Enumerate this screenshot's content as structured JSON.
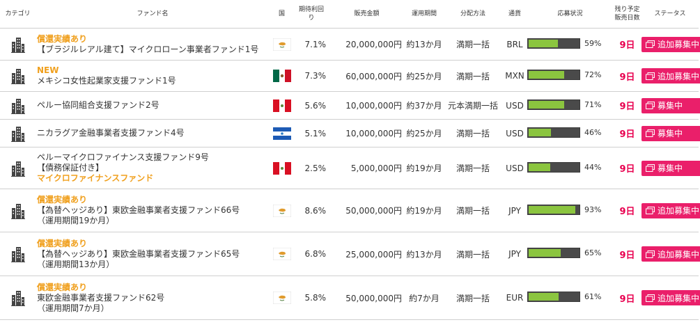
{
  "headers": {
    "category": "カテゴリ",
    "fund_name": "ファンド名",
    "country": "国",
    "yield_l1": "期待利回",
    "yield_l2": "り",
    "amount": "販売金額",
    "period": "運用期間",
    "distribution": "分配方法",
    "currency": "通貨",
    "status_progress": "応募状況",
    "days_l1": "残り予定",
    "days_l2": "販売日数",
    "status": "ステータス"
  },
  "rows": [
    {
      "tag": "償還実績あり",
      "name_lines": [
        "【ブラジルレアル建て】マイクロローン事業者ファンド1号"
      ],
      "tag_bottom": "",
      "flag": "cyprus-flag",
      "yield": "7.1%",
      "amount": "20,000,000円",
      "period": "約13か月",
      "distribution": "満期一括",
      "currency": "BRL",
      "progress": 59,
      "pct": "59%",
      "days": "9日",
      "button": "追加募集中"
    },
    {
      "tag": "NEW",
      "name_lines": [
        "メキシコ女性起業家支援ファンド1号"
      ],
      "tag_bottom": "",
      "flag": "mexico-flag",
      "yield": "7.3%",
      "amount": "60,000,000円",
      "period": "約25か月",
      "distribution": "満期一括",
      "currency": "MXN",
      "progress": 72,
      "pct": "72%",
      "days": "9日",
      "button": "追加募集中"
    },
    {
      "tag": "",
      "name_lines": [
        "ペルー協同組合支援ファンド2号"
      ],
      "tag_bottom": "",
      "flag": "peru-flag",
      "yield": "5.6%",
      "amount": "10,000,000円",
      "period": "約37か月",
      "distribution": "元本満期一括",
      "currency": "USD",
      "progress": 71,
      "pct": "71%",
      "days": "9日",
      "button": "募集中"
    },
    {
      "tag": "",
      "name_lines": [
        "ニカラグア金融事業者支援ファンド4号"
      ],
      "tag_bottom": "",
      "flag": "nicaragua-flag",
      "yield": "5.1%",
      "amount": "10,000,000円",
      "period": "約25か月",
      "distribution": "満期一括",
      "currency": "USD",
      "progress": 46,
      "pct": "46%",
      "days": "9日",
      "button": "募集中"
    },
    {
      "tag": "",
      "name_lines": [
        "ペルーマイクロファイナンス支援ファンド9号",
        "【債務保証付き】"
      ],
      "tag_bottom": "マイクロファイナンスファンド",
      "flag": "peru-flag",
      "yield": "2.5%",
      "amount": "5,000,000円",
      "period": "約19か月",
      "distribution": "満期一括",
      "currency": "USD",
      "progress": 44,
      "pct": "44%",
      "days": "9日",
      "button": "募集中"
    },
    {
      "tag": "償還実績あり",
      "name_lines": [
        "【為替ヘッジあり】東欧金融事業者支援ファンド66号",
        "（運用期間19か月）"
      ],
      "tag_bottom": "",
      "flag": "cyprus-flag",
      "yield": "8.6%",
      "amount": "50,000,000円",
      "period": "約19か月",
      "distribution": "満期一括",
      "currency": "JPY",
      "progress": 93,
      "pct": "93%",
      "days": "9日",
      "button": "追加募集中"
    },
    {
      "tag": "償還実績あり",
      "name_lines": [
        "【為替ヘッジあり】東欧金融事業者支援ファンド65号",
        "（運用期間13か月）"
      ],
      "tag_bottom": "",
      "flag": "cyprus-flag",
      "yield": "6.8%",
      "amount": "25,000,000円",
      "period": "約13か月",
      "distribution": "満期一括",
      "currency": "JPY",
      "progress": 65,
      "pct": "65%",
      "days": "9日",
      "button": "追加募集中"
    },
    {
      "tag": "償還実績あり",
      "name_lines": [
        "東欧金融事業者支援ファンド62号",
        "（運用期間7か月）"
      ],
      "tag_bottom": "",
      "flag": "cyprus-flag",
      "yield": "5.8%",
      "amount": "50,000,000円",
      "period": "約7か月",
      "distribution": "満期一括",
      "currency": "EUR",
      "progress": 61,
      "pct": "61%",
      "days": "9日",
      "button": "追加募集中"
    }
  ],
  "colors": {
    "accent": "#ea1f6a",
    "tag": "#f0a01e",
    "bar_fill": "#8bc53f",
    "bar_bg": "#4a4a4a"
  }
}
